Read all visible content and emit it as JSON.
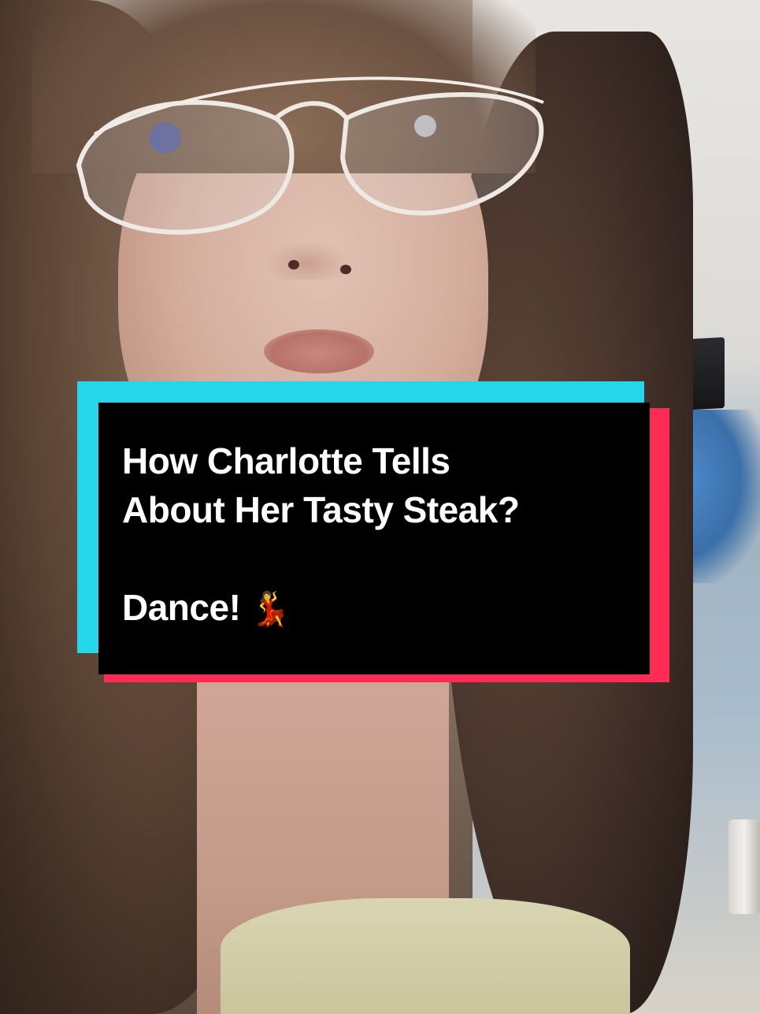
{
  "caption": {
    "line1": "How Charlotte Tells",
    "line2": "About Her Tasty Steak?",
    "line3": "Dance!",
    "emoji": "💃"
  },
  "colors": {
    "cyan": "#25d6ea",
    "red": "#fe2c55",
    "card_background": "#000000",
    "caption_text": "#ffffff"
  }
}
